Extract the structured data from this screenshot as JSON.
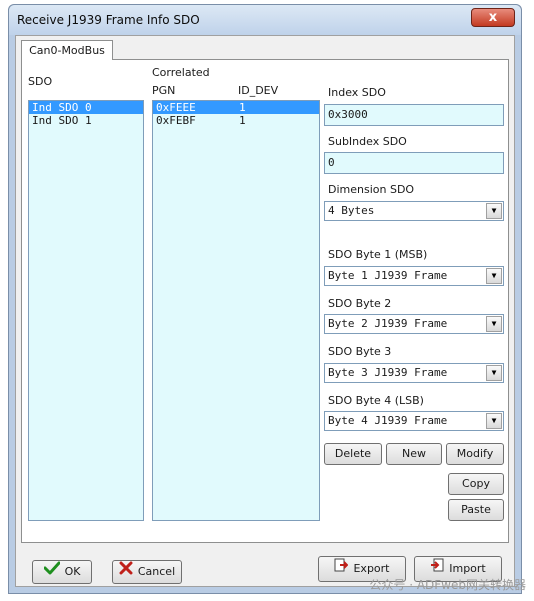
{
  "window": {
    "title": "Receive J1939 Frame Info SDO",
    "close_label": "x"
  },
  "tab": {
    "label": "Can0-ModBus"
  },
  "sdo": {
    "label": "SDO",
    "items": [
      "Ind SDO 0",
      "Ind SDO 1"
    ]
  },
  "correlated": {
    "label": "Correlated",
    "columns": [
      "PGN",
      "ID_DEV"
    ],
    "rows": [
      {
        "pgn": "0xFEEE",
        "id_dev": "1"
      },
      {
        "pgn": "0xFEBF",
        "id_dev": "1"
      }
    ]
  },
  "index_sdo": {
    "label": "Index SDO",
    "value": "0x3000"
  },
  "subindex_sdo": {
    "label": "SubIndex SDO",
    "value": "0"
  },
  "dimension_sdo": {
    "label": "Dimension SDO",
    "value": "4 Bytes"
  },
  "bytes": [
    {
      "label": "SDO Byte 1 (MSB)",
      "value": "Byte 1 J1939 Frame"
    },
    {
      "label": "SDO Byte 2",
      "value": "Byte 2 J1939 Frame"
    },
    {
      "label": "SDO Byte 3",
      "value": "Byte 3 J1939 Frame"
    },
    {
      "label": "SDO Byte 4 (LSB)",
      "value": "Byte 4 J1939 Frame"
    }
  ],
  "actions": {
    "delete": "Delete",
    "new": "New",
    "modify": "Modify",
    "copy": "Copy",
    "paste": "Paste"
  },
  "footer": {
    "ok": "OK",
    "cancel": "Cancel",
    "export": "Export",
    "import": "Import"
  },
  "watermark": "公众号 · ADFweb网关转换器"
}
